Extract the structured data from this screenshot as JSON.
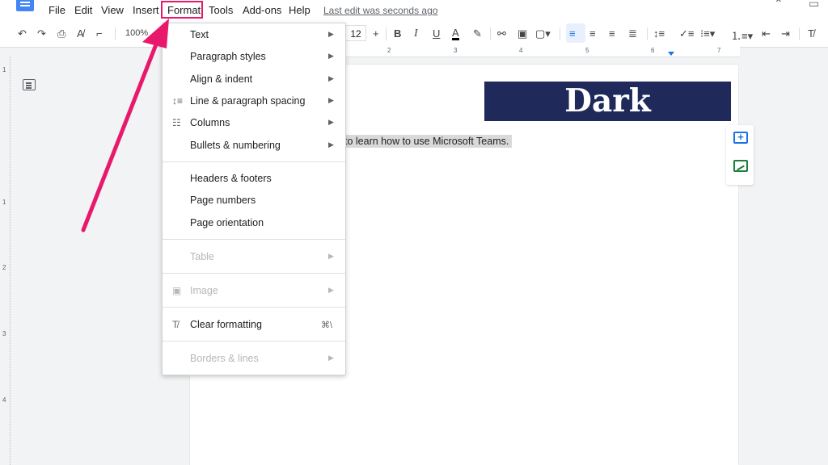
{
  "menubar": {
    "items": [
      "File",
      "Edit",
      "View",
      "Insert",
      "Format",
      "Tools",
      "Add-ons",
      "Help"
    ],
    "last_edit": "Last edit was seconds ago"
  },
  "toolbar": {
    "zoom": "100%",
    "font_size": "12",
    "active_alignment": "left",
    "icons": [
      "undo-icon",
      "redo-icon",
      "print-icon",
      "spellcheck-icon",
      "paint-format-icon",
      "bold-icon",
      "italic-icon",
      "underline-icon",
      "text-color-icon",
      "highlight-icon",
      "link-icon",
      "comment-icon",
      "image-icon",
      "align-left-icon",
      "align-center-icon",
      "align-right-icon",
      "justify-icon",
      "line-spacing-icon",
      "checklist-icon",
      "bulleted-list-icon",
      "numbered-list-icon",
      "decrease-indent-icon",
      "increase-indent-icon",
      "clear-formatting-icon"
    ],
    "bold": "B",
    "italic": "I",
    "underline": "U",
    "text_color": "A",
    "plus": "+"
  },
  "ruler": {
    "top_numbers": [
      "2",
      "3",
      "4",
      "5",
      "6",
      "7"
    ],
    "left_numbers": [
      "1",
      "1",
      "2",
      "3",
      "4"
    ]
  },
  "document": {
    "selected_text": "to learn how to use Microsoft Teams."
  },
  "watermark": {
    "text": "Dark Business",
    "background": "#1f2a5a"
  },
  "format_menu": {
    "items": [
      {
        "label": "Text",
        "submenu": true,
        "disabled": false
      },
      {
        "label": "Paragraph styles",
        "submenu": true,
        "disabled": false
      },
      {
        "label": "Align & indent",
        "submenu": true,
        "disabled": false
      },
      {
        "label": "Line & paragraph spacing",
        "submenu": true,
        "disabled": false,
        "icon": "line-spacing-icon"
      },
      {
        "label": "Columns",
        "submenu": true,
        "disabled": false,
        "icon": "columns-icon"
      },
      {
        "label": "Bullets & numbering",
        "submenu": true,
        "disabled": false
      },
      {
        "label": "Headers & footers",
        "submenu": false,
        "disabled": false
      },
      {
        "label": "Page numbers",
        "submenu": false,
        "disabled": false
      },
      {
        "label": "Page orientation",
        "submenu": false,
        "disabled": false
      },
      {
        "label": "Table",
        "submenu": true,
        "disabled": true
      },
      {
        "label": "Image",
        "submenu": true,
        "disabled": true,
        "icon": "image-icon"
      },
      {
        "label": "Clear formatting",
        "submenu": false,
        "disabled": false,
        "icon": "clear-formatting-icon",
        "shortcut": "⌘\\"
      },
      {
        "label": "Borders & lines",
        "submenu": true,
        "disabled": true
      }
    ]
  },
  "annotation": {
    "arrow_color": "#e8196b",
    "highlight_target": "Format"
  }
}
